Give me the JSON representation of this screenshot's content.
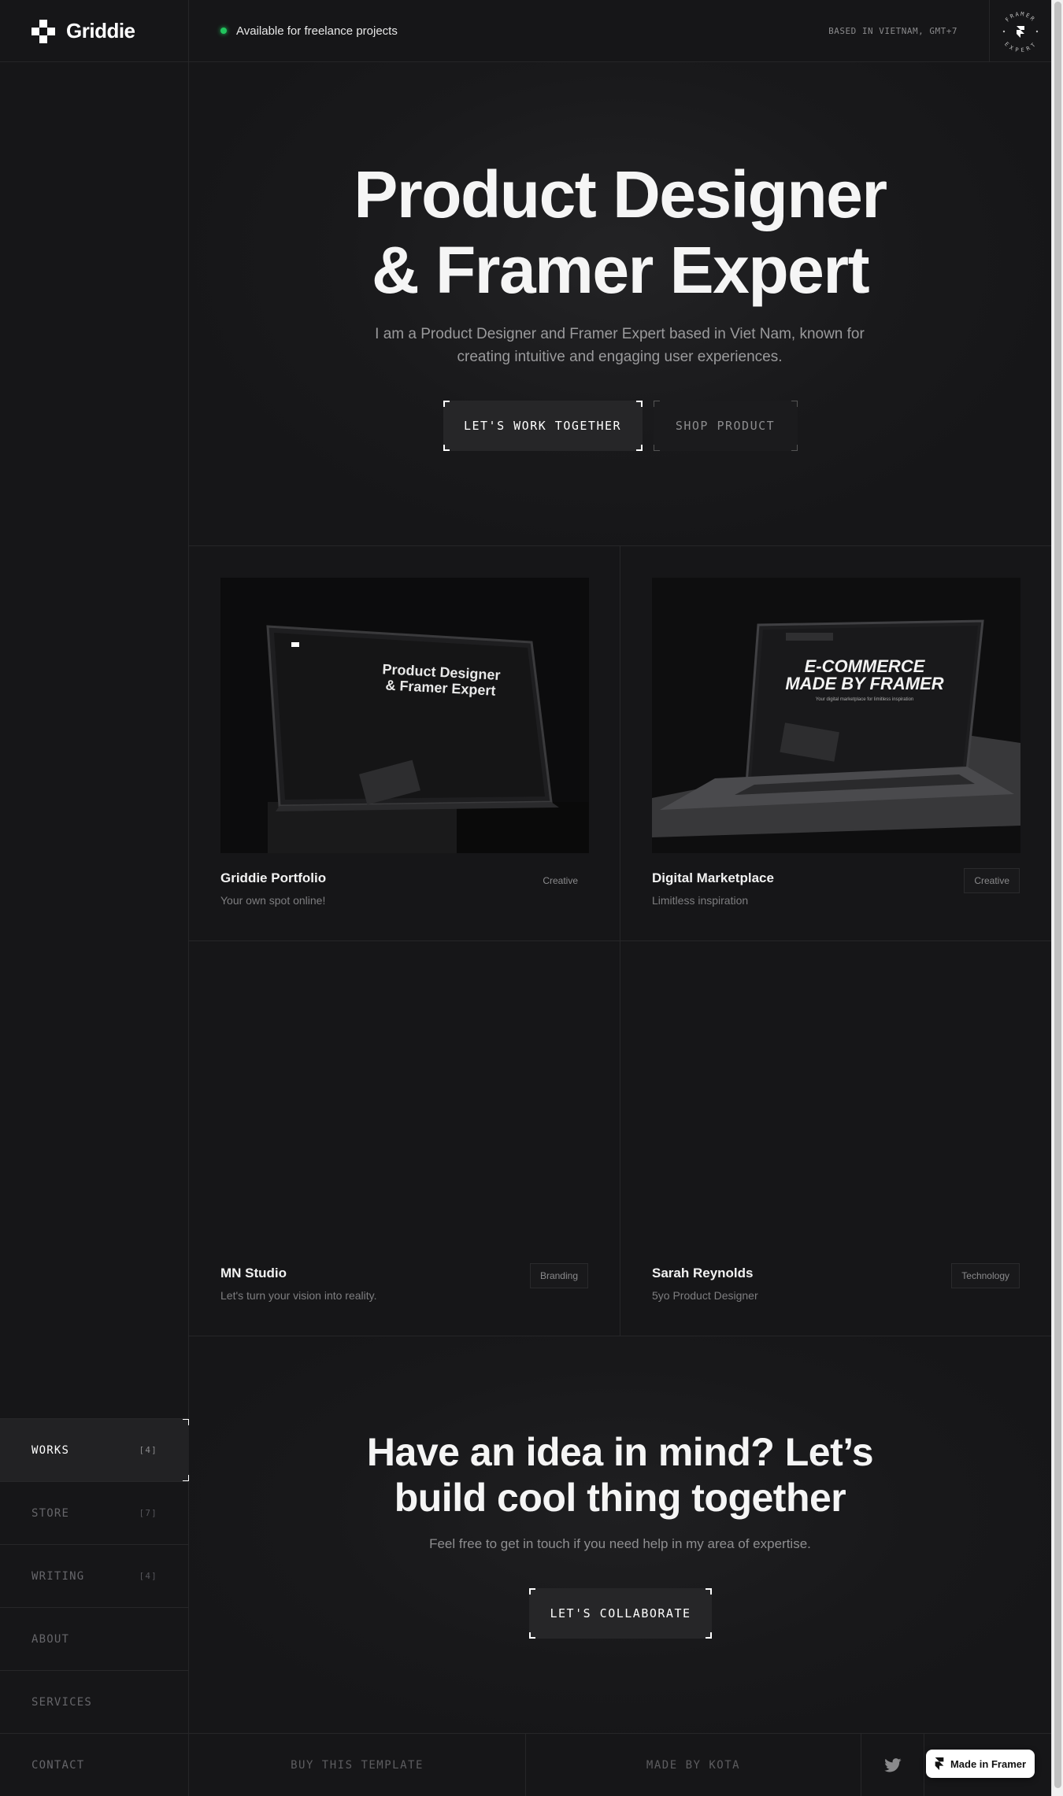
{
  "header": {
    "logo_text": "Griddie",
    "status_text": "Available for freelance projects",
    "location_text": "BASED IN VIETNAM, GMT+7",
    "badge": {
      "top_text": "FRAMER",
      "bottom_text": "EXPERT"
    }
  },
  "sidebar": {
    "items": [
      {
        "label": "WORKS",
        "count": "[4]"
      },
      {
        "label": "STORE",
        "count": "[7]"
      },
      {
        "label": "WRITING",
        "count": "[4]"
      },
      {
        "label": "ABOUT",
        "count": ""
      },
      {
        "label": "SERVICES",
        "count": ""
      },
      {
        "label": "CONTACT",
        "count": ""
      }
    ]
  },
  "hero": {
    "title_line1": "Product Designer",
    "title_line2": "& Framer Expert",
    "description": "I am a Product Designer and Framer Expert based in Viet Nam, known for creating intuitive and engaging user experiences.",
    "primary_button": "LET'S WORK TOGETHER",
    "secondary_button": "SHOP PRODUCT"
  },
  "works": [
    {
      "title": "Griddie Portfolio",
      "subtitle": "Your own spot online!",
      "tag": "Creative",
      "screen_line1": "Product Designer",
      "screen_line2": "& Framer Expert"
    },
    {
      "title": "Digital Marketplace",
      "subtitle": "Limitless inspiration",
      "tag": "Creative",
      "screen_line1": "E-COMMERCE",
      "screen_line2": "MADE BY FRAMER",
      "screen_caption": "Your digital marketplace for limitless inspiration"
    },
    {
      "title": "MN Studio",
      "subtitle": "Let's turn your vision into reality.",
      "tag": "Branding"
    },
    {
      "title": "Sarah Reynolds",
      "subtitle": "5yo Product Designer",
      "tag": "Technology"
    }
  ],
  "cta": {
    "title_line1": "Have an idea in mind? Let’s",
    "title_line2": "build cool thing together",
    "description": "Feel free to get in touch if you need help in my area of expertise.",
    "button": "LET'S COLLABORATE"
  },
  "footer": {
    "buy_template": "BUY THIS TEMPLATE",
    "made_by": "MADE BY KOTA",
    "made_in_framer": "Made in Framer"
  },
  "icons": [
    "griddie-logo-icon",
    "status-dot-icon",
    "framer-icon",
    "twitter-icon",
    "framer-badge-icon"
  ],
  "colors": {
    "background": "#161618",
    "accent_green": "#22c55e",
    "border": "#262628"
  }
}
